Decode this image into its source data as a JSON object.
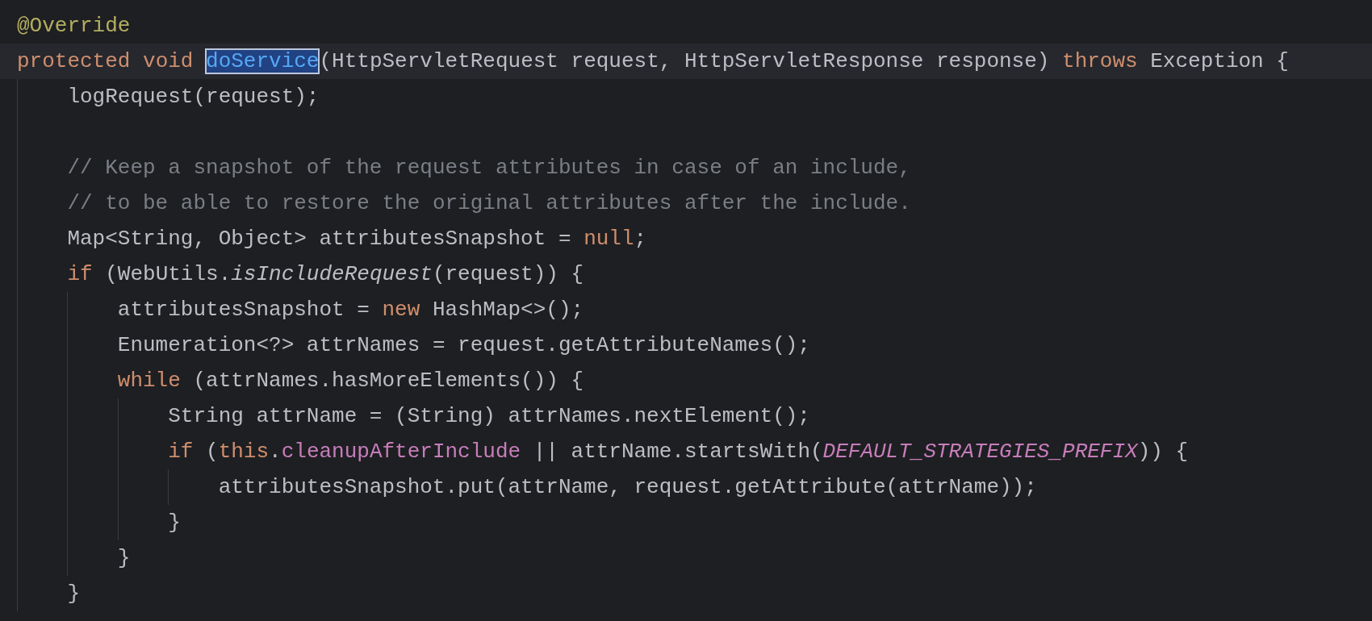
{
  "lines": [
    {
      "current": false,
      "tokens": [
        {
          "text": "@Override",
          "kind": "annotation"
        }
      ]
    },
    {
      "current": true,
      "tokens": [
        {
          "text": "protected void ",
          "kind": "keyword"
        },
        {
          "text": "doService",
          "kind": "declaration",
          "selected": true
        },
        {
          "text": "(HttpServletRequest request, HttpServletResponse response) ",
          "kind": "plain"
        },
        {
          "text": "throws ",
          "kind": "keyword"
        },
        {
          "text": "Exception {",
          "kind": "plain"
        }
      ],
      "children": [
        {
          "current": false,
          "tokens": [
            {
              "text": "logRequest(request);",
              "kind": "plain"
            }
          ]
        },
        {
          "current": false
        },
        {
          "current": false,
          "tokens": [
            {
              "text": "// Keep a snapshot of the request attributes in case of an include,",
              "kind": "comment"
            }
          ]
        },
        {
          "current": false,
          "tokens": [
            {
              "text": "// to be able to restore the original attributes after the include.",
              "kind": "comment"
            }
          ]
        },
        {
          "current": false,
          "tokens": [
            {
              "text": "Map<String, Object> attributesSnapshot = ",
              "kind": "plain"
            },
            {
              "text": "null",
              "kind": "keyword"
            },
            {
              "text": ";",
              "kind": "plain"
            }
          ]
        },
        {
          "current": false,
          "tokens": [
            {
              "text": "if ",
              "kind": "keyword"
            },
            {
              "text": "(WebUtils.",
              "kind": "plain"
            },
            {
              "text": "isIncludeRequest",
              "kind": "static-call"
            },
            {
              "text": "(request)) {",
              "kind": "plain"
            }
          ],
          "children": [
            {
              "current": false,
              "tokens": [
                {
                  "text": "attributesSnapshot = ",
                  "kind": "plain"
                },
                {
                  "text": "new ",
                  "kind": "keyword"
                },
                {
                  "text": "HashMap<>();",
                  "kind": "plain"
                }
              ]
            },
            {
              "current": false,
              "tokens": [
                {
                  "text": "Enumeration<?> attrNames = request.getAttributeNames();",
                  "kind": "plain"
                }
              ]
            },
            {
              "current": false,
              "tokens": [
                {
                  "text": "while ",
                  "kind": "keyword"
                },
                {
                  "text": "(attrNames.hasMoreElements()) {",
                  "kind": "plain"
                }
              ],
              "children": [
                {
                  "current": false,
                  "tokens": [
                    {
                      "text": "String attrName = (String) attrNames.nextElement();",
                      "kind": "plain"
                    }
                  ]
                },
                {
                  "current": false,
                  "tokens": [
                    {
                      "text": "if ",
                      "kind": "keyword"
                    },
                    {
                      "text": "(",
                      "kind": "plain"
                    },
                    {
                      "text": "this",
                      "kind": "keyword"
                    },
                    {
                      "text": ".",
                      "kind": "plain"
                    },
                    {
                      "text": "cleanupAfterInclude",
                      "kind": "field"
                    },
                    {
                      "text": " || attrName.startsWith(",
                      "kind": "plain"
                    },
                    {
                      "text": "DEFAULT_STRATEGIES_PREFIX",
                      "kind": "constant"
                    },
                    {
                      "text": ")) {",
                      "kind": "plain"
                    }
                  ],
                  "children": [
                    {
                      "current": false,
                      "tokens": [
                        {
                          "text": "attributesSnapshot.put(attrName, request.getAttribute(attrName));",
                          "kind": "plain"
                        }
                      ]
                    }
                  ]
                },
                {
                  "current": false,
                  "tokens": [
                    {
                      "text": "}",
                      "kind": "plain"
                    }
                  ]
                }
              ]
            },
            {
              "current": false,
              "tokens": [
                {
                  "text": "}",
                  "kind": "plain"
                }
              ]
            }
          ]
        },
        {
          "current": false,
          "tokens": [
            {
              "text": "}",
              "kind": "plain"
            }
          ]
        }
      ]
    }
  ]
}
